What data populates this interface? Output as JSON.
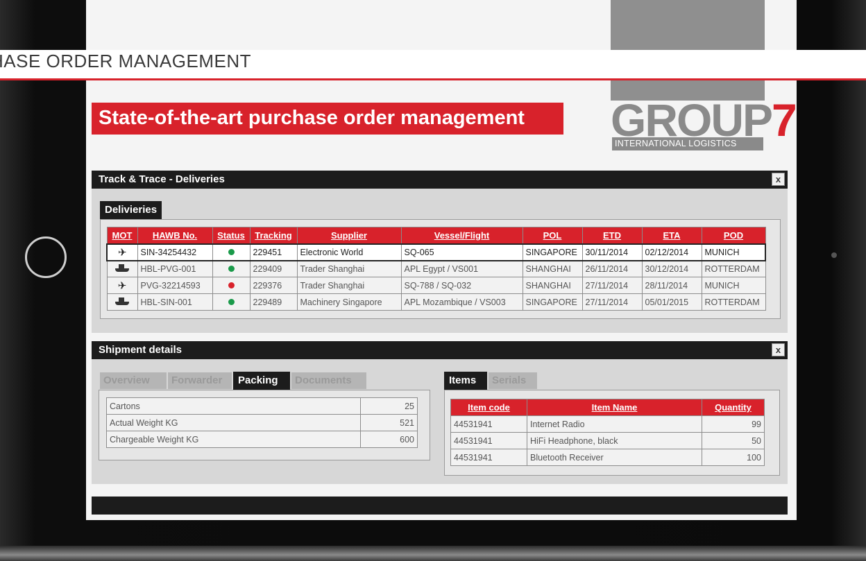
{
  "page": {
    "banner_text": "HASE ORDER MANAGEMENT",
    "hero_title": "State-of-the-art purchase order management",
    "logo_word": "GROUP",
    "logo_digit": "7",
    "logo_tagline": "INTERNATIONAL LOGISTICS",
    "accent_color": "#d8222b"
  },
  "track_trace": {
    "title": "Track & Trace - Deliveries",
    "close_label": "x",
    "tab_label": "Delivieries",
    "columns": [
      "MOT",
      "HAWB No.",
      "Status",
      "Tracking",
      "Supplier",
      "Vessel/Flight",
      "POL",
      "ETD",
      "ETA",
      "POD"
    ],
    "rows": [
      {
        "mot": "plane-icon",
        "hawb": "SIN-34254432",
        "status": "green",
        "tracking": "229451",
        "supplier": "Electronic World",
        "vessel": "SQ-065",
        "pol": "SINGAPORE",
        "etd": "30/11/2014",
        "eta": "02/12/2014",
        "pod": "MUNICH"
      },
      {
        "mot": "ship-icon",
        "hawb": "HBL-PVG-001",
        "status": "green",
        "tracking": "229409",
        "supplier": "Trader Shanghai",
        "vessel": "APL Egypt / VS001",
        "pol": "SHANGHAI",
        "etd": "26/11/2014",
        "eta": "30/12/2014",
        "pod": "ROTTERDAM"
      },
      {
        "mot": "plane-icon",
        "hawb": "PVG-32214593",
        "status": "red",
        "tracking": "229376",
        "supplier": "Trader Shanghai",
        "vessel": "SQ-788 / SQ-032",
        "pol": "SHANGHAI",
        "etd": "27/11/2014",
        "eta": "28/11/2014",
        "pod": "MUNICH"
      },
      {
        "mot": "ship-icon",
        "hawb": "HBL-SIN-001",
        "status": "green",
        "tracking": "229489",
        "supplier": "Machinery Singapore",
        "vessel": "APL Mozambique / VS003",
        "pol": "SINGAPORE",
        "etd": "27/11/2014",
        "eta": "05/01/2015",
        "pod": "ROTTERDAM"
      }
    ],
    "status_colors": {
      "green": "#1a9a4a",
      "red": "#d8222b"
    }
  },
  "shipment": {
    "title": "Shipment details",
    "close_label": "x",
    "left_tabs": [
      "Overview",
      "Forwarder",
      "Packing",
      "Documents"
    ],
    "left_active_tab": "Packing",
    "packing": [
      {
        "label": "Cartons",
        "value": "25"
      },
      {
        "label": "Actual Weight KG",
        "value": "521"
      },
      {
        "label": "Chargeable Weight KG",
        "value": "600"
      }
    ],
    "right_tabs": [
      "Items",
      "Serials"
    ],
    "right_active_tab": "Items",
    "item_columns": [
      "Item code",
      "Item Name",
      "Quantity"
    ],
    "items": [
      {
        "code": "44531941",
        "name": "Internet Radio",
        "qty": "99"
      },
      {
        "code": "44531941",
        "name": "HiFi Headphone, black",
        "qty": "50"
      },
      {
        "code": "44531941",
        "name": "Bluetooth Receiver",
        "qty": "100"
      }
    ]
  }
}
